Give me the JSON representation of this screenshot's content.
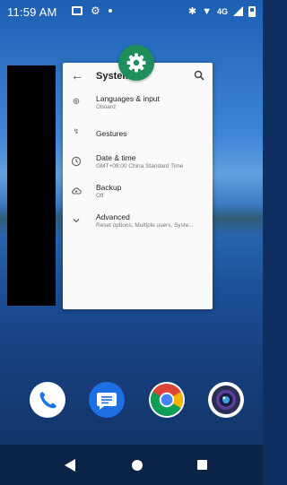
{
  "status_bar": {
    "time": "11:59 AM",
    "network": "4G",
    "icons": [
      "image-icon",
      "gear-icon",
      "dot-icon",
      "bluetooth-icon",
      "wifi-icon",
      "signal-icon",
      "battery-icon"
    ]
  },
  "recent_app": {
    "title": "System",
    "header_icons": [
      "back-arrow-icon",
      "search-icon"
    ],
    "badge_icon": "settings-gear-icon",
    "badge_color": "#1e8e5b",
    "items": [
      {
        "icon": "globe-icon",
        "title": "Languages & input",
        "subtitle": "Gboard"
      },
      {
        "icon": "gestures-icon",
        "title": "Gestures",
        "subtitle": ""
      },
      {
        "icon": "clock-icon",
        "title": "Date & time",
        "subtitle": "GMT+08:00 China Standard Time"
      },
      {
        "icon": "cloud-backup-icon",
        "title": "Backup",
        "subtitle": "Off"
      },
      {
        "icon": "chevron-down-icon",
        "title": "Advanced",
        "subtitle": "Reset options, Multiple users, Syste..."
      }
    ]
  },
  "dock": {
    "apps": [
      {
        "name": "Phone",
        "icon": "phone-icon",
        "color": "#ffffff"
      },
      {
        "name": "Messages",
        "icon": "messages-icon",
        "color": "#1e6fe3"
      },
      {
        "name": "Chrome",
        "icon": "chrome-icon",
        "color": "#ffffff"
      },
      {
        "name": "Camera",
        "icon": "camera-icon",
        "color": "#ffffff"
      }
    ]
  },
  "nav_bar": {
    "buttons": [
      "back-button",
      "home-button",
      "recents-button"
    ]
  }
}
